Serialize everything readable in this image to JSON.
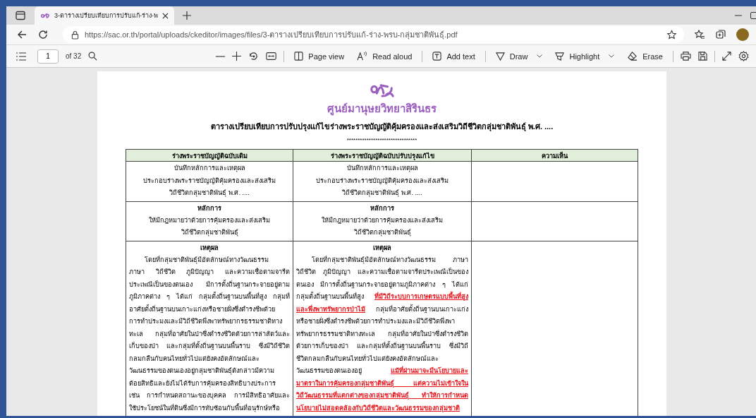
{
  "browser": {
    "tab": {
      "title": "3-ตารางเปรียบเทียบการปรับแก้-ร่าง-พ",
      "selected": true
    },
    "url": "https://sac.or.th/portal/uploads/ckeditor/images/files/3-ตารางเปรียบเทียบการปรับแก้-ร่าง-พรบ-กลุ่มชาติพันธุ์.pdf"
  },
  "pdf_toolbar": {
    "page": "1",
    "page_count": "of 32",
    "tools": [
      {
        "label": "Page view",
        "kind": "page",
        "dropdown": false
      },
      {
        "label": "Read aloud",
        "kind": "read",
        "dropdown": false
      },
      {
        "label": "Add text",
        "kind": "text",
        "dropdown": false
      },
      {
        "label": "Draw",
        "kind": "draw",
        "dropdown": true
      },
      {
        "label": "Highlight",
        "kind": "highlight",
        "dropdown": true
      },
      {
        "label": "Erase",
        "kind": "erase",
        "dropdown": false
      }
    ]
  },
  "document": {
    "org_name": "ศูนย์มานุษยวิทยาสิรินธร",
    "title": "ตารางเปรียบเทียบการปรับปรุงแก้ไขร่างพระราชบัญญัติคุ้มครองและส่งเสริมวิถีชีวิตกลุ่มชาติพันธุ์ พ.ศ. ....",
    "separator": "********************************",
    "table": {
      "columns": [
        "ร่างพระราชบัญญัติฉบับเดิม",
        "ร่างพระราชบัญญัติฉบับปรับปรุงแก้ไข",
        "ความเห็น"
      ],
      "rows": [
        {
          "cells": [
            {
              "kind": "centered",
              "lines": [
                [
                  {
                    "text": "บันทึกหลักการและเหตุผล",
                    "kind": "plain"
                  }
                ],
                [
                  {
                    "text": "ประกอบร่างพระราชบัญญัติคุ้มครองและส่งเสริม",
                    "kind": "plain"
                  }
                ],
                [
                  {
                    "text": "วิถีชีวิตกลุ่มชาติพันธุ์ พ.ศ. ....",
                    "kind": "plain"
                  }
                ]
              ]
            },
            {
              "kind": "centered",
              "lines": [
                [
                  {
                    "text": "บันทึกหลักการและเหตุผล",
                    "kind": "plain"
                  }
                ],
                [
                  {
                    "text": "ประกอบร่างพระราชบัญญัติคุ้มครองและส่งเสริม",
                    "kind": "plain"
                  }
                ],
                [
                  {
                    "text": "วิถีชีวิตกลุ่มชาติพันธุ์ พ.ศ. ....",
                    "kind": "plain"
                  }
                ]
              ]
            }
          ]
        },
        {
          "cells": [
            {
              "heading": "หลักการ",
              "kind": "centered",
              "lines": [
                [
                  {
                    "text": "ให้มีกฎหมายว่าด้วยการคุ้มครองและส่งเสริม",
                    "kind": "plain"
                  }
                ],
                [
                  {
                    "text": "วิถีชีวิตกลุ่มชาติพันธุ์",
                    "kind": "plain"
                  }
                ]
              ]
            },
            {
              "heading": "หลักการ",
              "kind": "centered",
              "lines": [
                [
                  {
                    "text": "ให้มีกฎหมายว่าด้วยการคุ้มครองและส่งเสริม",
                    "kind": "plain"
                  }
                ],
                [
                  {
                    "text": "วิถีชีวิตกลุ่มชาติพันธุ์",
                    "kind": "plain"
                  }
                ]
              ]
            }
          ]
        },
        {
          "cells": [
            {
              "heading": "เหตุผล",
              "kind": "justified",
              "lines": [
                [
                  {
                    "text": "โดยที่กลุ่มชาติพันธุ์มีอัตลักษณ์ทางวัฒนธรรม",
                    "kind": "plain"
                  }
                ],
                [
                  {
                    "text": "ภาษา วิถีชีวิต ภูมิปัญญา และความเชื่อตามจารีต",
                    "kind": "plain"
                  }
                ],
                [
                  {
                    "text": "ประเพณีเป็นของตนเอง มีการตั้งถิ่นฐานกระจายอยู่ตาม",
                    "kind": "plain"
                  }
                ],
                [
                  {
                    "text": "ภูมิภาคต่าง ๆ ได้แก่ กลุ่มตั้งถิ่นฐานบนพื้นที่สูง กลุ่มที่",
                    "kind": "plain"
                  }
                ],
                [
                  {
                    "text": "อาศัยตั้งถิ่นฐานบนเกาะแก่งหรือชายฝั่งซึ่งดำรงชีพด้วย",
                    "kind": "plain"
                  }
                ],
                [
                  {
                    "text": "การทำประมงและมีวิถีชีวิตพึ่งพาทรัพยากรธรรมชาติทาง",
                    "kind": "plain"
                  }
                ],
                [
                  {
                    "text": "ทะเล กลุ่มที่อาศัยในป่าซึ่งดำรงชีวิตด้วยการล่าสัตว์และ",
                    "kind": "plain"
                  }
                ],
                [
                  {
                    "text": "เก็บของป่า และกลุ่มที่ตั้งถิ่นฐานบนพื้นราบ ซึ่งมีวิถีชีวิต",
                    "kind": "plain"
                  }
                ],
                [
                  {
                    "text": "กลมกลืนกับคนไทยทั่วไปแต่ยังคงอัตลักษณ์และ",
                    "kind": "plain"
                  }
                ],
                [
                  {
                    "text": "วัฒนธรรมของตนเองอยู่กลุ่มชาติพันธุ์ดังกล่าวมีความ",
                    "kind": "plain"
                  }
                ],
                [
                  {
                    "text": "ด้อยสิทธิและยังไม่ได้รับการคุ้มครองสิทธิบางประการ",
                    "kind": "plain"
                  }
                ],
                [
                  {
                    "text": "เช่น การกำหนดสถานะของบุคคล การมีสิทธิอาศัยและ",
                    "kind": "plain"
                  }
                ],
                [
                  {
                    "text": "ใช้ประโยชน์ในที่ดินซึ่งมีการทับซ้อนกับพื้นที่อนุรักษ์หรือ",
                    "kind": "plain"
                  }
                ]
              ]
            },
            {
              "heading": "เหตุผล",
              "kind": "justified",
              "lines": [
                [
                  {
                    "text": "โดยที่กลุ่มชาติพันธุ์มีอัตลักษณ์ทางวัฒนธรรม ภาษา",
                    "kind": "plain"
                  }
                ],
                [
                  {
                    "text": "วิถีชีวิต ภูมิปัญญา และความเชื่อตามจารีตประเพณีเป็นของ",
                    "kind": "plain"
                  }
                ],
                [
                  {
                    "text": "ตนเอง มีการตั้งถิ่นฐานกระจายอยู่ตามภูมิภาคต่าง ๆ ได้แก่",
                    "kind": "plain"
                  }
                ],
                [
                  {
                    "text": "กลุ่มตั้งถิ่นฐานบนพื้นที่สูง ",
                    "kind": "plain"
                  },
                  {
                    "text": "ที่มีวิถีระบบการเกษตรแบบพื้นที่สูง",
                    "kind": "amended"
                  }
                ],
                [
                  {
                    "text": "และพึ่งพาทรัพยากรป่าไม้",
                    "kind": "amended"
                  },
                  {
                    "text": " กลุ่มที่อาศัยตั้งถิ่นฐานบนเกาะแก่ง",
                    "kind": "plain"
                  }
                ],
                [
                  {
                    "text": "หรือชายฝั่งซึ่งดำรงชีพด้วยการทำประมงและมีวิถีชีวิตพึ่งพา",
                    "kind": "plain"
                  }
                ],
                [
                  {
                    "text": "ทรัพยากรธรรมชาติทางทะเล กลุ่มที่อาศัยในป่าซึ่งดำรงชีวิต",
                    "kind": "plain"
                  }
                ],
                [
                  {
                    "text": "ด้วยการเก็บของป่า และกลุ่มที่ตั้งถิ่นฐานบนพื้นราบ ซึ่งมีวิถี",
                    "kind": "plain"
                  }
                ],
                [
                  {
                    "text": "ชีวิตกลมกลืนกับคนไทยทั่วไปแต่ยังคงอัตลักษณ์และ",
                    "kind": "plain"
                  }
                ],
                [
                  {
                    "text": "วัฒนธรรมของตนเองอยู่ ",
                    "kind": "plain"
                  },
                  {
                    "text": "แม้ที่ผ่านมาจะมีนโยบายและ",
                    "kind": "amended"
                  }
                ],
                [
                  {
                    "text": "มาตราในการคุ้มครองกลุ่มชาติพันธุ์ แต่ความไม่เข้าใจใน",
                    "kind": "amended"
                  }
                ],
                [
                  {
                    "text": "วิถีวัฒนธรรมที่แตกต่างของกลุ่มชาติพันธุ์ ทำให้การกำหนด",
                    "kind": "amended"
                  }
                ],
                [
                  {
                    "text": "นโยบายไม่สอดคล้องกับวิถีชีวิตและวัฒนธรรมของกลุ่มชาติ",
                    "kind": "amended"
                  }
                ]
              ]
            }
          ]
        }
      ]
    }
  }
}
